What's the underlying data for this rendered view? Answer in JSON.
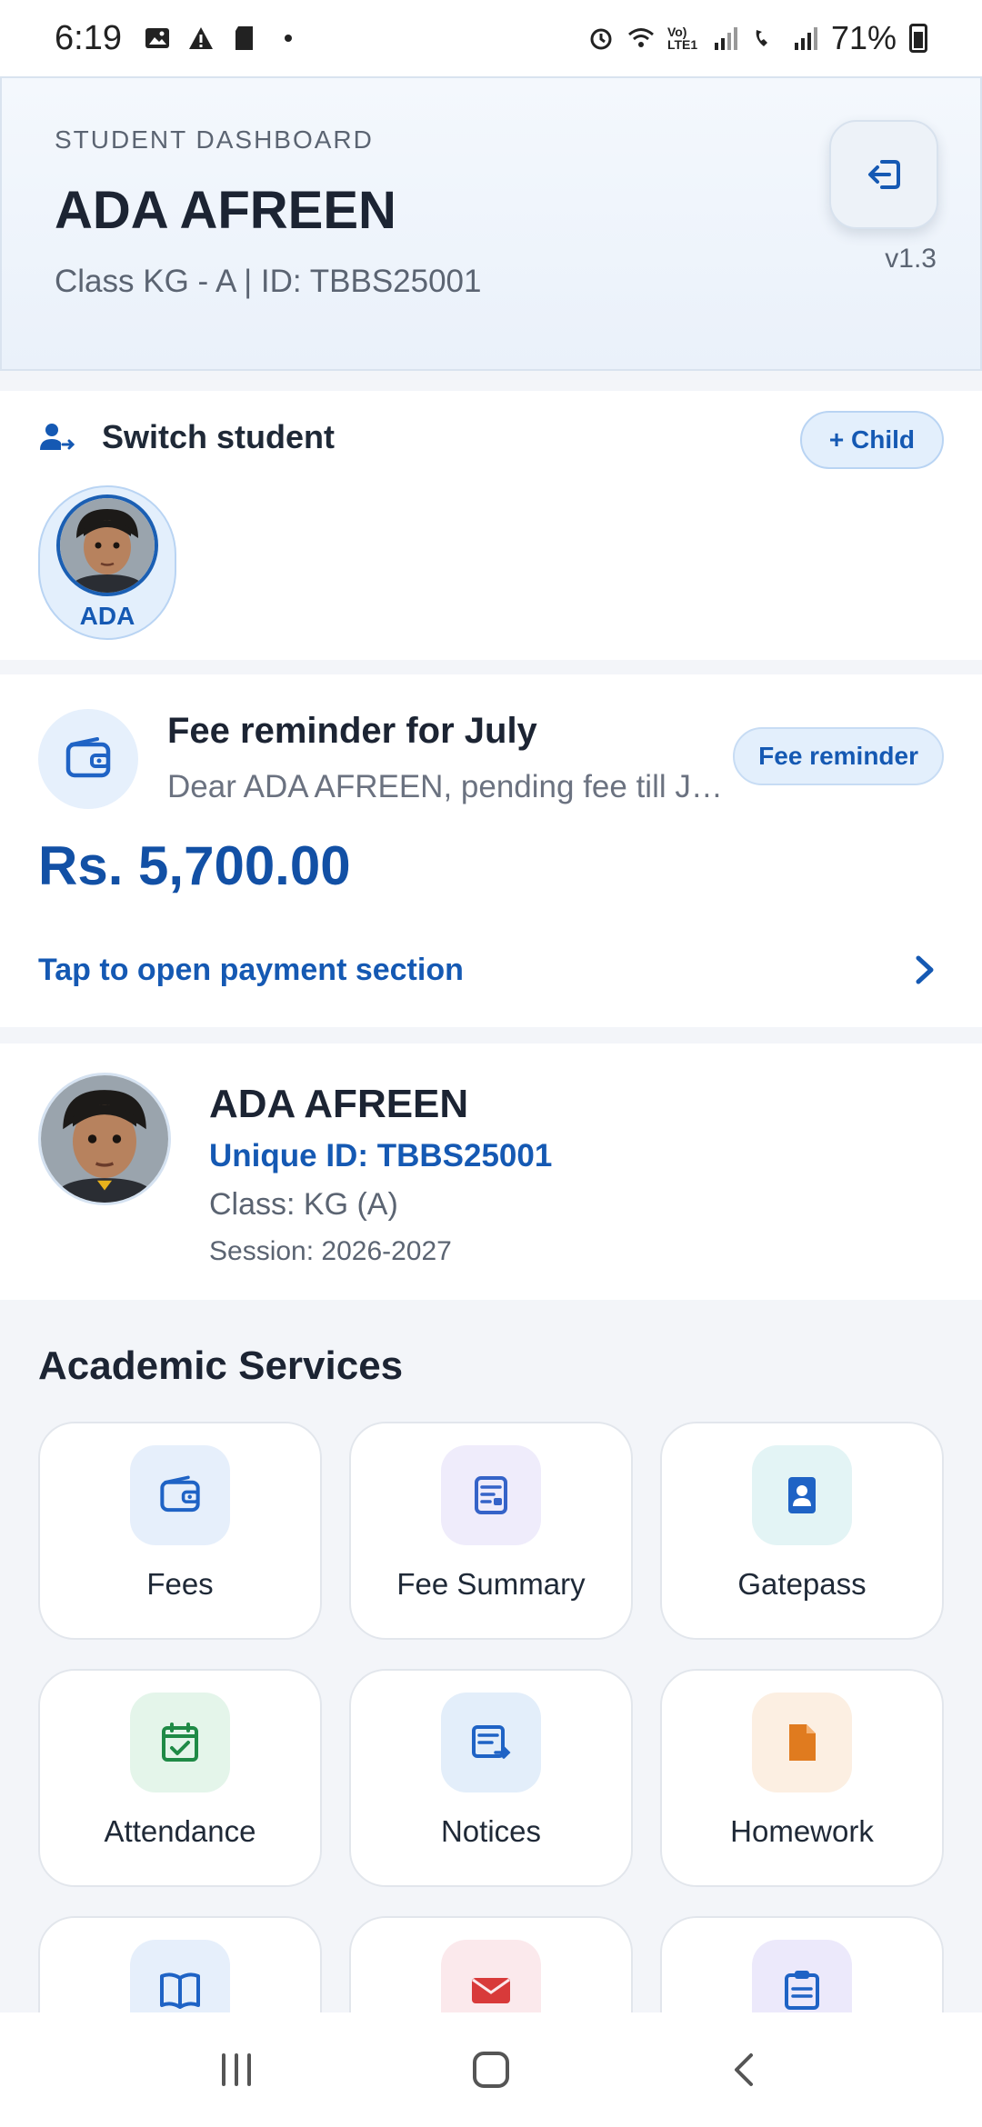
{
  "status_bar": {
    "time": "6:19",
    "battery": "71%",
    "network_label": "Vo) LTE1"
  },
  "header": {
    "eyebrow": "STUDENT DASHBOARD",
    "student_name": "ADA AFREEN",
    "subtitle": "Class KG - A | ID: TBBS25001",
    "version": "v1.3",
    "logout_icon": "logout-icon"
  },
  "switch_student": {
    "title": "Switch student",
    "add_child_label": "+ Child",
    "students": [
      {
        "label": "ADA"
      }
    ]
  },
  "fee_reminder": {
    "title": "Fee reminder for July",
    "message": "Dear ADA AFREEN, pending fee till J…",
    "badge": "Fee reminder",
    "amount": "Rs. 5,700.00",
    "link": "Tap to open payment section"
  },
  "profile": {
    "name": "ADA AFREEN",
    "unique_id": "Unique ID: TBBS25001",
    "class": "Class: KG (A)",
    "session": "Session: 2026-2027"
  },
  "services": {
    "title": "Academic Services",
    "tiles": [
      {
        "label": "Fees",
        "icon": "wallet-icon",
        "bg": "#e6effb",
        "fg": "#1f63c5"
      },
      {
        "label": "Fee Summary",
        "icon": "receipt-icon",
        "bg": "#efecfb",
        "fg": "#3563c8"
      },
      {
        "label": "Gatepass",
        "icon": "badge-icon",
        "bg": "#e3f4f5",
        "fg": "#1f63c5"
      },
      {
        "label": "Attendance",
        "icon": "calendar-check-icon",
        "bg": "#e4f5ea",
        "fg": "#1f8a46"
      },
      {
        "label": "Notices",
        "icon": "notice-icon",
        "bg": "#e3eefa",
        "fg": "#1f63c5"
      },
      {
        "label": "Homework",
        "icon": "document-icon",
        "bg": "#fcefe2",
        "fg": "#e07b1f"
      },
      {
        "label": "",
        "icon": "book-icon",
        "bg": "#e6effb",
        "fg": "#1f63c5"
      },
      {
        "label": "",
        "icon": "mail-icon",
        "bg": "#fbe9ec",
        "fg": "#d83a3a"
      },
      {
        "label": "",
        "icon": "clipboard-icon",
        "bg": "#ece9fb",
        "fg": "#1f63c5"
      }
    ]
  },
  "colors": {
    "primary": "#1559b3",
    "amount": "#1250a5",
    "background": "#f3f5f9"
  }
}
